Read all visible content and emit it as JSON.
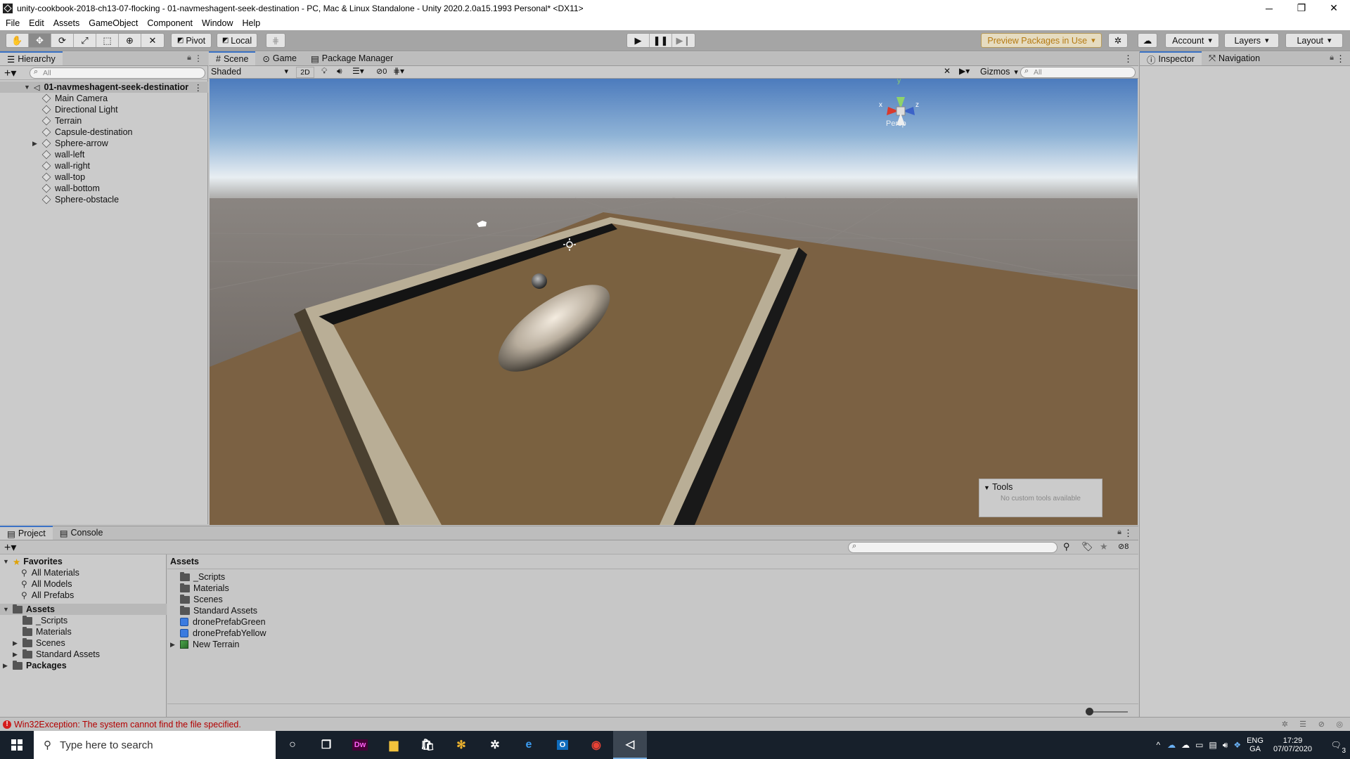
{
  "window": {
    "title": "unity-cookbook-2018-ch13-07-flocking - 01-navmeshagent-seek-destination - PC, Mac & Linux Standalone - Unity 2020.2.0a15.1993 Personal* <DX11>",
    "minimize": "─",
    "restore": "❐",
    "close": "✕"
  },
  "menu": [
    "File",
    "Edit",
    "Assets",
    "GameObject",
    "Component",
    "Window",
    "Help"
  ],
  "toolbar": {
    "pivot": "Pivot",
    "local": "Local",
    "preview_packages": "Preview Packages in Use",
    "account": "Account",
    "layers": "Layers",
    "layout": "Layout"
  },
  "hierarchy": {
    "tab": "Hierarchy",
    "search_placeholder": "All",
    "scene_root": "01-navmeshagent-seek-destinatior",
    "items": [
      "Main Camera",
      "Directional Light",
      "Terrain",
      "Capsule-destination",
      "Sphere-arrow",
      "wall-left",
      "wall-right",
      "wall-top",
      "wall-bottom",
      "Sphere-obstacle"
    ]
  },
  "scene_view": {
    "tabs": [
      "Scene",
      "Game",
      "Package Manager"
    ],
    "shading_mode": "Shaded",
    "mode_2d": "2D",
    "hidden_count": "0",
    "gizmos": "Gizmos",
    "search_placeholder": "All",
    "gizmo_axes": [
      "y",
      "x",
      "z"
    ],
    "persp_label": "Persp",
    "tools_overlay": {
      "title": "Tools",
      "message": "No custom tools available"
    }
  },
  "inspector": {
    "tabs": [
      "Inspector",
      "Navigation"
    ]
  },
  "project": {
    "tabs": [
      "Project",
      "Console"
    ],
    "favorites": {
      "label": "Favorites",
      "items": [
        "All Materials",
        "All Models",
        "All Prefabs"
      ]
    },
    "assets_tree": {
      "label": "Assets",
      "items": [
        "_Scripts",
        "Materials",
        "Scenes",
        "Standard Assets"
      ]
    },
    "packages_label": "Packages",
    "breadcrumb": "Assets",
    "assets_list": [
      {
        "name": "_Scripts",
        "icon": "folder-icon"
      },
      {
        "name": "Materials",
        "icon": "folder-icon"
      },
      {
        "name": "Scenes",
        "icon": "folder-icon"
      },
      {
        "name": "Standard Assets",
        "icon": "folder-icon"
      },
      {
        "name": "dronePrefabGreen",
        "icon": "prefab-icon"
      },
      {
        "name": "dronePrefabYellow",
        "icon": "prefab-icon"
      },
      {
        "name": "New Terrain",
        "icon": "terrain-icon"
      }
    ],
    "hidden_packages_count": "8"
  },
  "status_bar": {
    "error_message": "Win32Exception: The system cannot find the file specified."
  },
  "taskbar": {
    "search_placeholder": "Type here to search",
    "apps": [
      "cortana-icon",
      "task-view-icon",
      "dreamweaver-icon",
      "file-explorer-icon",
      "store-icon",
      "slack-icon",
      "settings-icon",
      "edge-icon",
      "outlook-icon",
      "chrome-icon",
      "unity-icon"
    ],
    "language": "ENG",
    "layout": "GA",
    "time": "17:29",
    "date": "07/07/2020",
    "notification_count": "3"
  },
  "colors": {
    "toolbar_bg": "#a5a5a5",
    "panel_bg": "#c2c2c2",
    "tab_accent": "#3a72c6",
    "sky_top": "#5b86be",
    "ground": "#6e6560",
    "terrain": "#7a5f3e",
    "error": "#b20000"
  }
}
